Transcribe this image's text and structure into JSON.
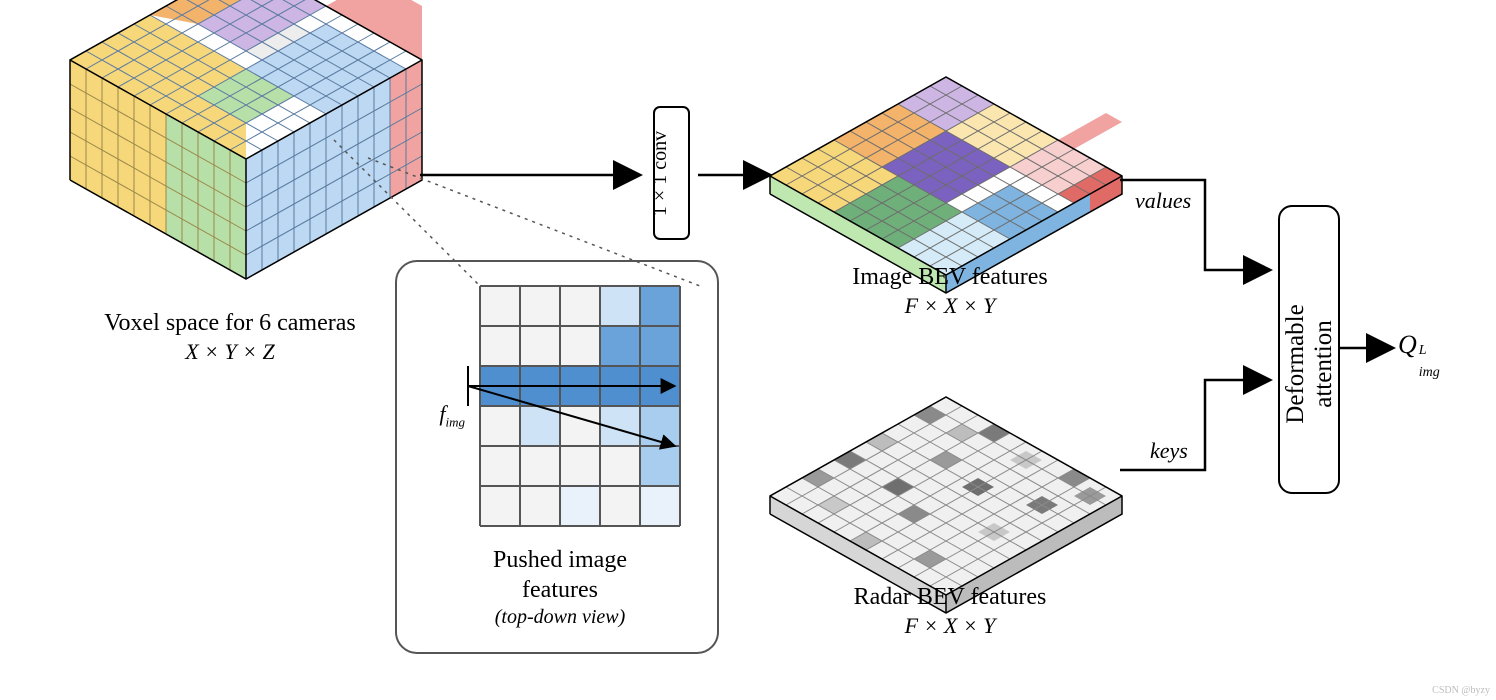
{
  "voxel": {
    "title": "Voxel space for 6 cameras",
    "dims": "X × Y × Z"
  },
  "pushed": {
    "title": "Pushed image",
    "title2": "features",
    "note": "(top-down view)",
    "fimg": "f",
    "fimg_sub": "img"
  },
  "conv": {
    "label": "1 × 1 conv"
  },
  "image_bev": {
    "title": "Image BEV features",
    "dims": "F × X × Y"
  },
  "radar_bev": {
    "title": "Radar BEV features",
    "dims": "F × X × Y"
  },
  "attn": {
    "label1": "Deformable",
    "label2": "attention",
    "values": "values",
    "keys": "keys"
  },
  "output": {
    "Q": "Q",
    "sub": "img",
    "sup": "L"
  },
  "watermark": "CSDN @byzy",
  "chart_data": {
    "type": "diagram",
    "nodes": [
      {
        "id": "voxel",
        "label": "Voxel space for 6 cameras",
        "dims": "X × Y × Z"
      },
      {
        "id": "pushed_features",
        "label": "Pushed image features (top-down view)",
        "input": "f_img"
      },
      {
        "id": "conv1x1",
        "label": "1 × 1 conv"
      },
      {
        "id": "image_bev",
        "label": "Image BEV features",
        "dims": "F × X × Y"
      },
      {
        "id": "radar_bev",
        "label": "Radar BEV features",
        "dims": "F × X × Y"
      },
      {
        "id": "deformable_attention",
        "label": "Deformable attention"
      },
      {
        "id": "output",
        "label": "Q_img^L"
      }
    ],
    "edges": [
      {
        "from": "voxel",
        "to": "conv1x1"
      },
      {
        "from": "pushed_features",
        "to": "voxel",
        "style": "detail"
      },
      {
        "from": "conv1x1",
        "to": "image_bev"
      },
      {
        "from": "image_bev",
        "to": "deformable_attention",
        "role": "values"
      },
      {
        "from": "radar_bev",
        "to": "deformable_attention",
        "role": "keys"
      },
      {
        "from": "deformable_attention",
        "to": "output"
      }
    ]
  }
}
